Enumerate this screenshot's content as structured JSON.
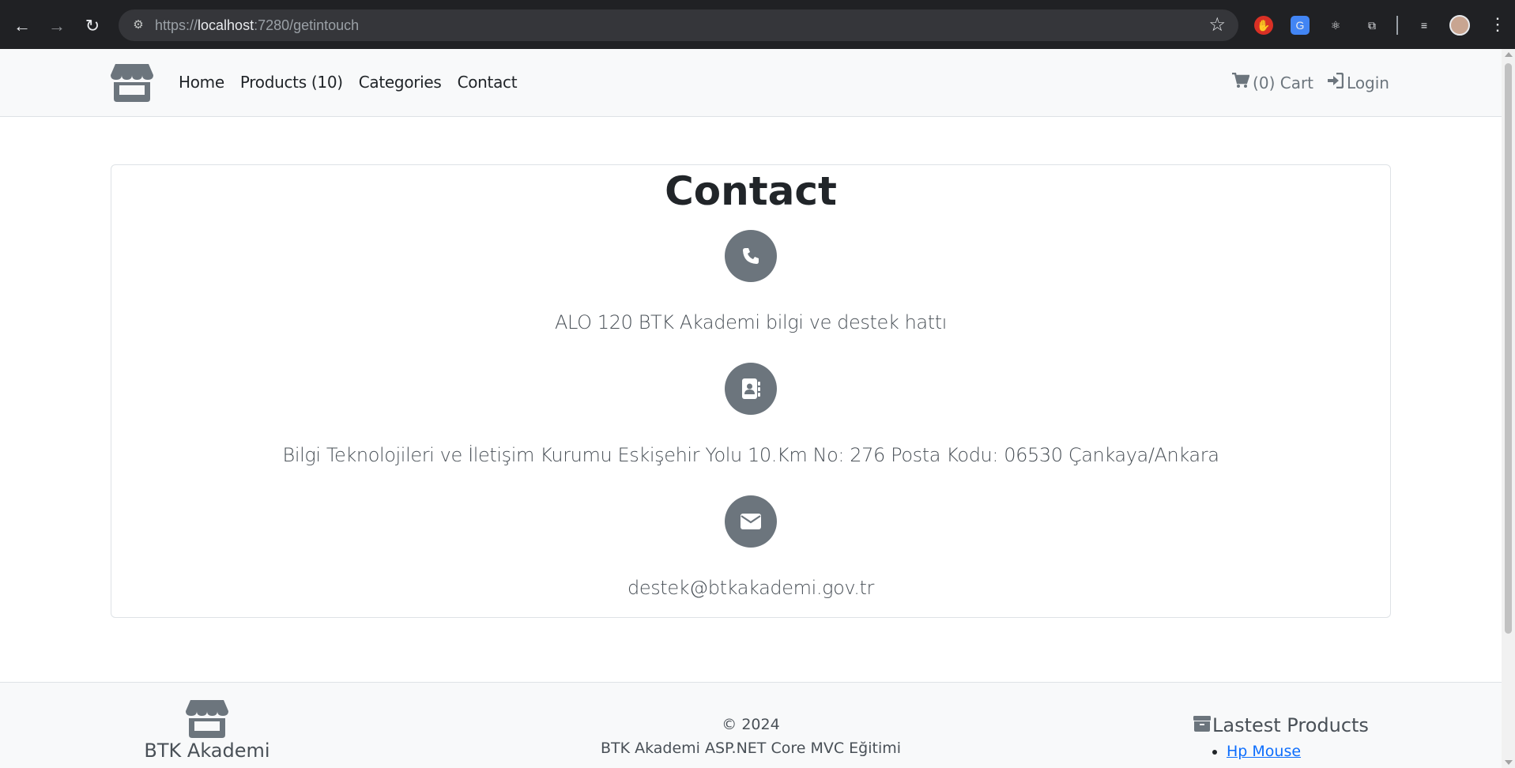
{
  "browser": {
    "url_host": "localhost",
    "url_prefix": "https://",
    "url_rest": ":7280/getintouch"
  },
  "nav": {
    "home": "Home",
    "products": "Products (10)",
    "categories": "Categories",
    "contact": "Contact",
    "cart": "(0) Cart",
    "login": "Login"
  },
  "contact": {
    "title": "Contact",
    "phone": "ALO 120 BTK Akademi bilgi ve destek hattı",
    "address": "Bilgi Teknolojileri ve İletişim Kurumu Eskişehir Yolu 10.Km No: 276 Posta Kodu: 06530 Çankaya/Ankara",
    "email": "destek@btkakademi.gov.tr"
  },
  "footer": {
    "brand_name": "BTK Akademi",
    "copyright": "© 2024",
    "course": "BTK Akademi ASP.NET Core MVC Eğitimi",
    "latest_title": "Lastest Products",
    "latest_items": [
      "Hp Mouse"
    ]
  },
  "colors": {
    "icon_circle": "#6c757d",
    "header_bg": "#f8f9fa",
    "link": "#0d6efd"
  },
  "icons": [
    "store-icon",
    "cart-icon",
    "login-icon",
    "phone-icon",
    "address-book-icon",
    "envelope-icon",
    "box-icon"
  ]
}
